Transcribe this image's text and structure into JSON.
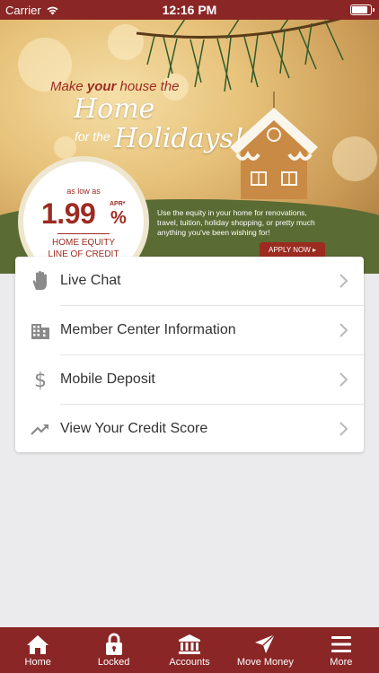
{
  "status_bar": {
    "carrier": "Carrier",
    "time": "12:16 PM"
  },
  "banner": {
    "headline_line1_pre": "Make ",
    "headline_line1_bold": "your",
    "headline_line1_post": " house the",
    "headline_home": "Home",
    "headline_for_the": "for the",
    "headline_holidays": "Holidays!",
    "rate_prefix": "as low as",
    "rate_value": "1.99",
    "rate_apr": "APR*",
    "rate_percent": "%",
    "product_line1": "HOME EQUITY",
    "product_line2": "LINE OF CREDIT",
    "copy": "Use the equity in your home for renovations, travel, tuition, holiday shopping, or pretty much anything you've been wishing for!",
    "apply_label": "APPLY NOW ▸"
  },
  "menu": {
    "items": [
      {
        "label": "Live Chat",
        "icon": "hand-icon"
      },
      {
        "label": "Member Center Information",
        "icon": "building-icon"
      },
      {
        "label": "Mobile Deposit",
        "icon": "dollar-icon"
      },
      {
        "label": "View Your Credit Score",
        "icon": "trend-up-icon"
      }
    ]
  },
  "tabs": [
    {
      "label": "Home",
      "icon": "home-icon"
    },
    {
      "label": "Locked",
      "icon": "lock-icon"
    },
    {
      "label": "Accounts",
      "icon": "bank-icon"
    },
    {
      "label": "Move Money",
      "icon": "send-icon"
    },
    {
      "label": "More",
      "icon": "menu-icon"
    }
  ],
  "colors": {
    "brand": "#8b2626",
    "accent_text": "#9c2b20",
    "background": "#ebebed"
  }
}
